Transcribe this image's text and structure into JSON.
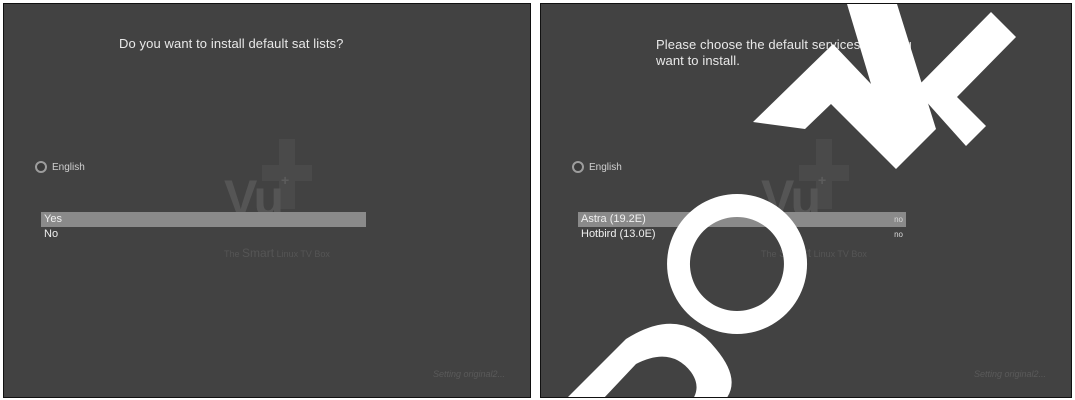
{
  "left_screen": {
    "title": "Do you want to install default sat lists?",
    "language": "English",
    "options": [
      {
        "label": "Yes",
        "selected": true
      },
      {
        "label": "No",
        "selected": false
      }
    ],
    "watermark": {
      "logo": "Vu",
      "superscript": "+",
      "tagline_pre": "The",
      "tagline_brand": "Smart",
      "tagline_post": "Linux TV Box"
    },
    "hint": "Setting original2..."
  },
  "right_screen": {
    "title": "Please choose the default services lists you want to install.",
    "language": "English",
    "options": [
      {
        "label": "Astra (19.2E)",
        "value": "no",
        "selected": true
      },
      {
        "label": "Hotbird (13.0E)",
        "value": "no",
        "selected": false
      }
    ],
    "watermark": {
      "logo": "Vu",
      "superscript": "+",
      "tagline_pre": "The",
      "tagline_brand": "Smart",
      "tagline_post": "Linux TV Box"
    },
    "hint": "Setting original2..."
  },
  "colors": {
    "screen_bg": "#424242",
    "highlight": "#8a8a8a",
    "stamp": "#ffffff"
  }
}
